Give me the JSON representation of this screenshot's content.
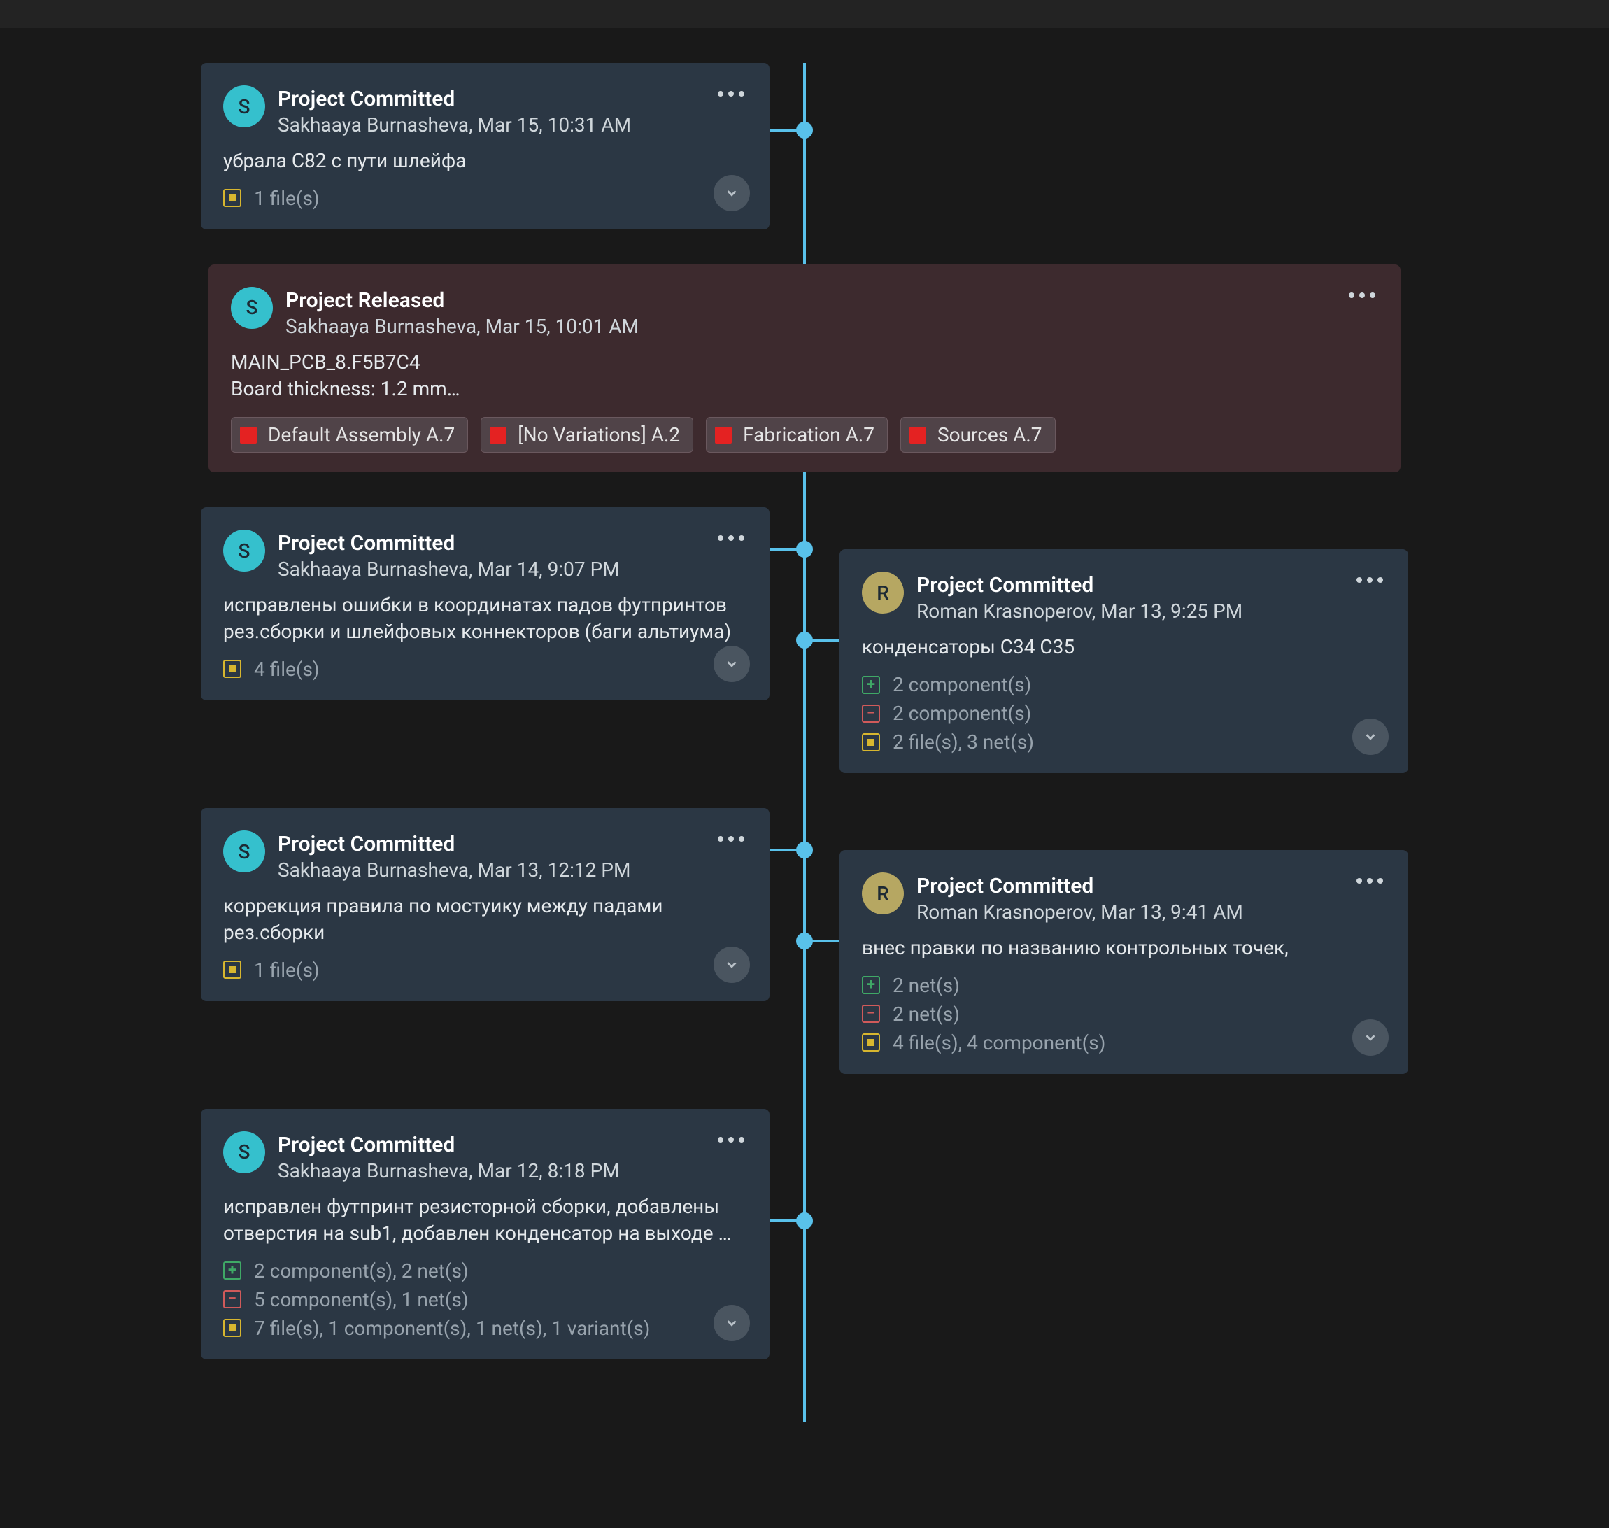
{
  "avatars": {
    "s": "S",
    "r": "R"
  },
  "events": [
    {
      "id": "ev0",
      "side": "left",
      "avatar": "s",
      "title": "Project Committed",
      "meta": "Sakhaaya Burnasheva, Mar 15, 10:31 AM",
      "body": "убрала С82 с пути шлейфа",
      "stats": {
        "mod": "1 file(s)"
      },
      "expand": true,
      "nodeTop": 94
    },
    {
      "id": "ev1",
      "side": "full",
      "avatar": "s",
      "title": "Project Released",
      "meta": "Sakhaaya Burnasheva, Mar 15, 10:01 AM",
      "body": "MAIN_PCB_8.F5B7C4\nBoard thickness: 1.2 mm…",
      "tags": [
        "Default Assembly A.7",
        "[No Variations] A.2",
        "Fabrication A.7",
        "Sources A.7"
      ],
      "expand": false
    },
    {
      "id": "ev2",
      "side": "left",
      "avatar": "s",
      "title": "Project Committed",
      "meta": "Sakhaaya Burnasheva, Mar 14, 9:07 PM",
      "body": "исправлены ошибки в координатах падов футпринтов рез.сборки и шлейфовых коннекторов (баги альтиума)",
      "stats": {
        "mod": "4 file(s)"
      },
      "expand": true
    },
    {
      "id": "ev3",
      "side": "right",
      "avatar": "r",
      "title": "Project Committed",
      "meta": "Roman Krasnoperov, Mar 13, 9:25 PM",
      "body": "конденсаторы С34 С35",
      "stats": {
        "plus": "2 component(s)",
        "minus": "2 component(s)",
        "mod": "2 file(s), 3 net(s)"
      },
      "expand": true
    },
    {
      "id": "ev4",
      "side": "left",
      "avatar": "s",
      "title": "Project Committed",
      "meta": "Sakhaaya Burnasheva, Mar 13, 12:12 PM",
      "body": "коррекция правила по мостуику между падами рез.сборки",
      "stats": {
        "mod": "1 file(s)"
      },
      "expand": true
    },
    {
      "id": "ev5",
      "side": "right",
      "avatar": "r",
      "title": "Project Committed",
      "meta": "Roman Krasnoperov, Mar 13, 9:41 AM",
      "body": "внес правки по названию контрольных точек,",
      "stats": {
        "plus": "2 net(s)",
        "minus": "2 net(s)",
        "mod": "4 file(s), 4 component(s)"
      },
      "expand": true
    },
    {
      "id": "ev6",
      "side": "left",
      "avatar": "s",
      "title": "Project Committed",
      "meta": "Sakhaaya Burnasheva, Mar 12, 8:18 PM",
      "body": "исправлен футпринт резисторной сборки, добавлены отверстия на sub1, добавлен конденсатор на выходе …",
      "stats": {
        "plus": "2 component(s), 2 net(s)",
        "minus": "5 component(s), 1 net(s)",
        "mod": "7 file(s), 1 component(s), 1 net(s), 1 variant(s)"
      },
      "expand": true
    }
  ]
}
